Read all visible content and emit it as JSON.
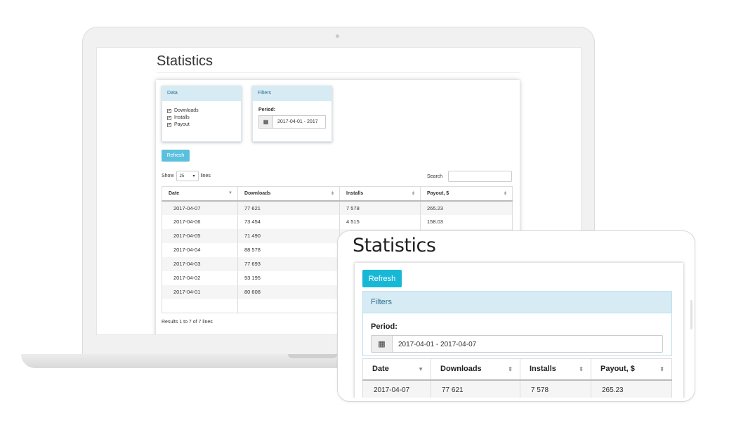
{
  "laptop": {
    "page_title": "Statistics",
    "data_box": {
      "header": "Data",
      "options": [
        {
          "label": "Downloads",
          "checked": true
        },
        {
          "label": "Installs",
          "checked": true
        },
        {
          "label": "Payout",
          "checked": true
        }
      ]
    },
    "filters_box": {
      "header": "Filters",
      "period_label": "Period:",
      "date_range": "2017-04-01 - 2017"
    },
    "refresh_label": "Refresh",
    "show_label": "Show",
    "page_size": "25",
    "lines_label": "lines",
    "search_label": "Search",
    "columns": [
      "Date",
      "Downloads",
      "Installs",
      "Payout, $"
    ],
    "rows": [
      {
        "date": "2017-04-07",
        "downloads": "77 621",
        "installs": "7 578",
        "payout": "265.23"
      },
      {
        "date": "2017-04-06",
        "downloads": "73 454",
        "installs": "4 515",
        "payout": "158.03"
      },
      {
        "date": "2017-04-05",
        "downloads": "71 490",
        "installs": "",
        "payout": ""
      },
      {
        "date": "2017-04-04",
        "downloads": "88 578",
        "installs": "",
        "payout": ""
      },
      {
        "date": "2017-04-03",
        "downloads": "77 693",
        "installs": "",
        "payout": ""
      },
      {
        "date": "2017-04-02",
        "downloads": "93 195",
        "installs": "",
        "payout": ""
      },
      {
        "date": "2017-04-01",
        "downloads": "80 608",
        "installs": "",
        "payout": ""
      }
    ],
    "results_text": "Results 1 to 7 of 7 lines"
  },
  "tablet": {
    "page_title": "Statistics",
    "refresh_label": "Refresh",
    "filters_header": "Filters",
    "period_label": "Period:",
    "date_range": "2017-04-01 - 2017-04-07",
    "columns": [
      "Date",
      "Downloads",
      "Installs",
      "Payout, $"
    ],
    "rows": [
      {
        "date": "2017-04-07",
        "downloads": "77 621",
        "installs": "7 578",
        "payout": "265.23"
      }
    ]
  },
  "icons": {
    "calendar": "calendar-icon",
    "sort_desc": "caret-down-icon",
    "sort_both": "sort-icon",
    "checkbox": "checkbox-checked-icon",
    "select_arrow": "caret-down-icon"
  },
  "colors": {
    "refresh_light": "#5bc0de",
    "refresh_tablet": "#17b8d6",
    "panel_header_bg": "#d6ebf4",
    "panel_header_text": "#31708f"
  }
}
